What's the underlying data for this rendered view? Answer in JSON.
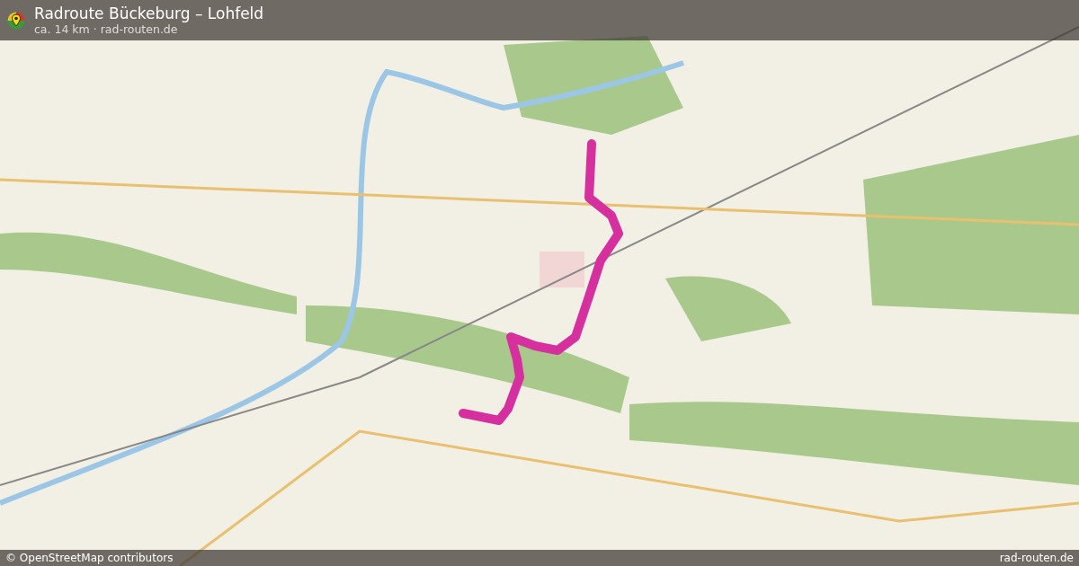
{
  "header": {
    "title": "Radroute Bückeburg – Lohfeld",
    "subtitle": "ca. 14 km · rad-routen.de"
  },
  "footer": {
    "attribution": "© OpenStreetMap contributors",
    "site": "rad-routen.de"
  }
}
